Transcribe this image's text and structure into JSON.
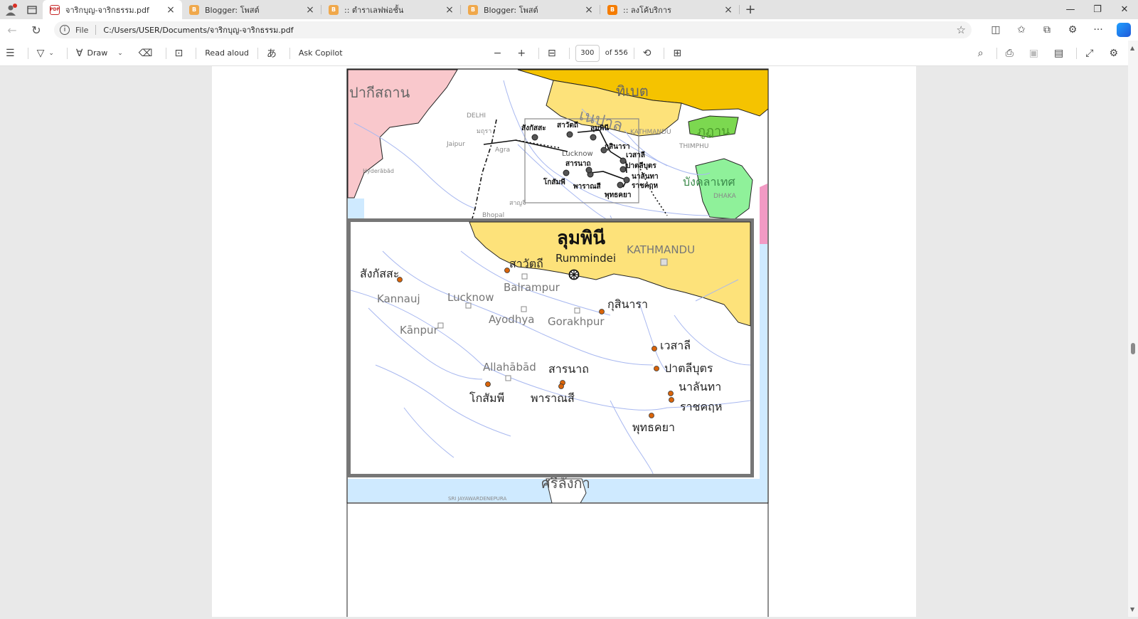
{
  "tabs": [
    {
      "title": "จาริกบุญ-จาริกธรรม.pdf",
      "icon": "pdf-icon",
      "active": true
    },
    {
      "title": "Blogger: โพสต์",
      "icon": "blogger-icon"
    },
    {
      "title": ":: ตำราเลฟพ่อชั้น",
      "icon": "blogger-icon"
    },
    {
      "title": "Blogger: โพสต์",
      "icon": "blogger-icon"
    },
    {
      "title": ":: ลงโค้บริการ",
      "icon": "blogger-icon"
    }
  ],
  "address": {
    "scheme": "File",
    "url": "C:/Users/USER/Documents/จาริกบุญ-จาริกธรรม.pdf"
  },
  "pdf_toolbar": {
    "draw_label": "Draw",
    "read_aloud_label": "Read aloud",
    "ask_copilot_label": "Ask Copilot",
    "page_current": "300",
    "page_total": "of 556"
  },
  "map": {
    "countries": {
      "pakistan": "ปากีสถาน",
      "tibet": "ทิเบต",
      "nepal": "เนปาล",
      "bhutan": "ภูฏาน",
      "bangladesh": "บังคลาเทศ",
      "srilanka": "ศรีลังกา"
    },
    "overview_cities": {
      "delhi": "DELHI",
      "jaipur": "Jaipur",
      "agra": "Agra",
      "mathura": "มถุรา",
      "hyderabad": "Hyderābād",
      "bhopal": "Bhopal",
      "sanchi": "สาญจี",
      "kathmandu": "KATHMANDU",
      "thimphu": "THIMPHU",
      "dhaka": "DHAKA",
      "sri_jaya": "SRI JAYAWARDENEPURA"
    },
    "overview_sites": {
      "sankassa": "สังกัสสะ",
      "savatthi": "สาวัตถี",
      "lumbini": "ลุมพินี",
      "kusinara": "กุสินารา",
      "lucknow": "Lucknow",
      "sarnath": "สารนาถ",
      "vesali": "เวสาลี",
      "pataliputra": "ปาตลีบุตร",
      "nalanda": "นาลันทา",
      "kosambi": "โกสัมพี",
      "varanasi": "พาราณสี",
      "rajagaha": "ราชคฤห",
      "bodhgaya": "พุทธคยา"
    },
    "inset": {
      "title": "ลุมพินี",
      "subtitle": "Rummindei",
      "kathmandu": "KATHMANDU",
      "sankassa": "สังกัสสะ",
      "savatthi": "สาวัตถี",
      "kannauj": "Kannauj",
      "lucknow": "Lucknow",
      "balrampur": "Balrampur",
      "kusinara": "กุสินารา",
      "ayodhya": "Ayodhya",
      "gorakhpur": "Gorakhpur",
      "kanpur": "Kānpur",
      "vesali": "เวสาลี",
      "allahabad": "Allahābād",
      "sarnath": "สารนาถ",
      "pataliputra": "ปาตลีบุตร",
      "nalanda": "นาลันทา",
      "kosambi": "โกสัมพี",
      "varanasi": "พาราณสี",
      "rajagaha": "ราชคฤห",
      "bodhgaya": "พุทธคยา"
    }
  },
  "colors": {
    "tibet": "#f5c300",
    "nepal": "#fde27a",
    "pakistan": "#f9c8cc",
    "bhutan": "#7cd850",
    "bangladesh": "#8ff19a",
    "water": "#cfeaff",
    "river": "#a8b8f0",
    "site": "#d9640a"
  }
}
